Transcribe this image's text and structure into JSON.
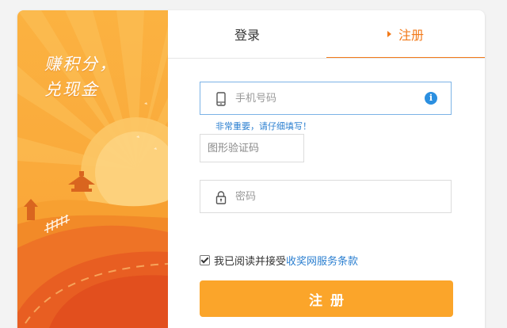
{
  "banner": {
    "slogan_line1": "赚积分，",
    "slogan_line2": "兑现金"
  },
  "tabs": {
    "login": "登录",
    "register": "注册"
  },
  "form": {
    "phone_placeholder": "手机号码",
    "phone_hint": "非常重要，请仔细填写！",
    "info_icon_glyph": "i",
    "captcha_placeholder": "图形验证码",
    "password_placeholder": "密码",
    "agree_text": "我已阅读并接受",
    "agree_link": "收奖网服务条款",
    "agree_checked": true,
    "submit_label": "注册"
  },
  "colors": {
    "accent": "#f27a1a",
    "submit_bg": "#fba52a",
    "link": "#2b7fd0",
    "active_border": "#7cb3e6"
  }
}
